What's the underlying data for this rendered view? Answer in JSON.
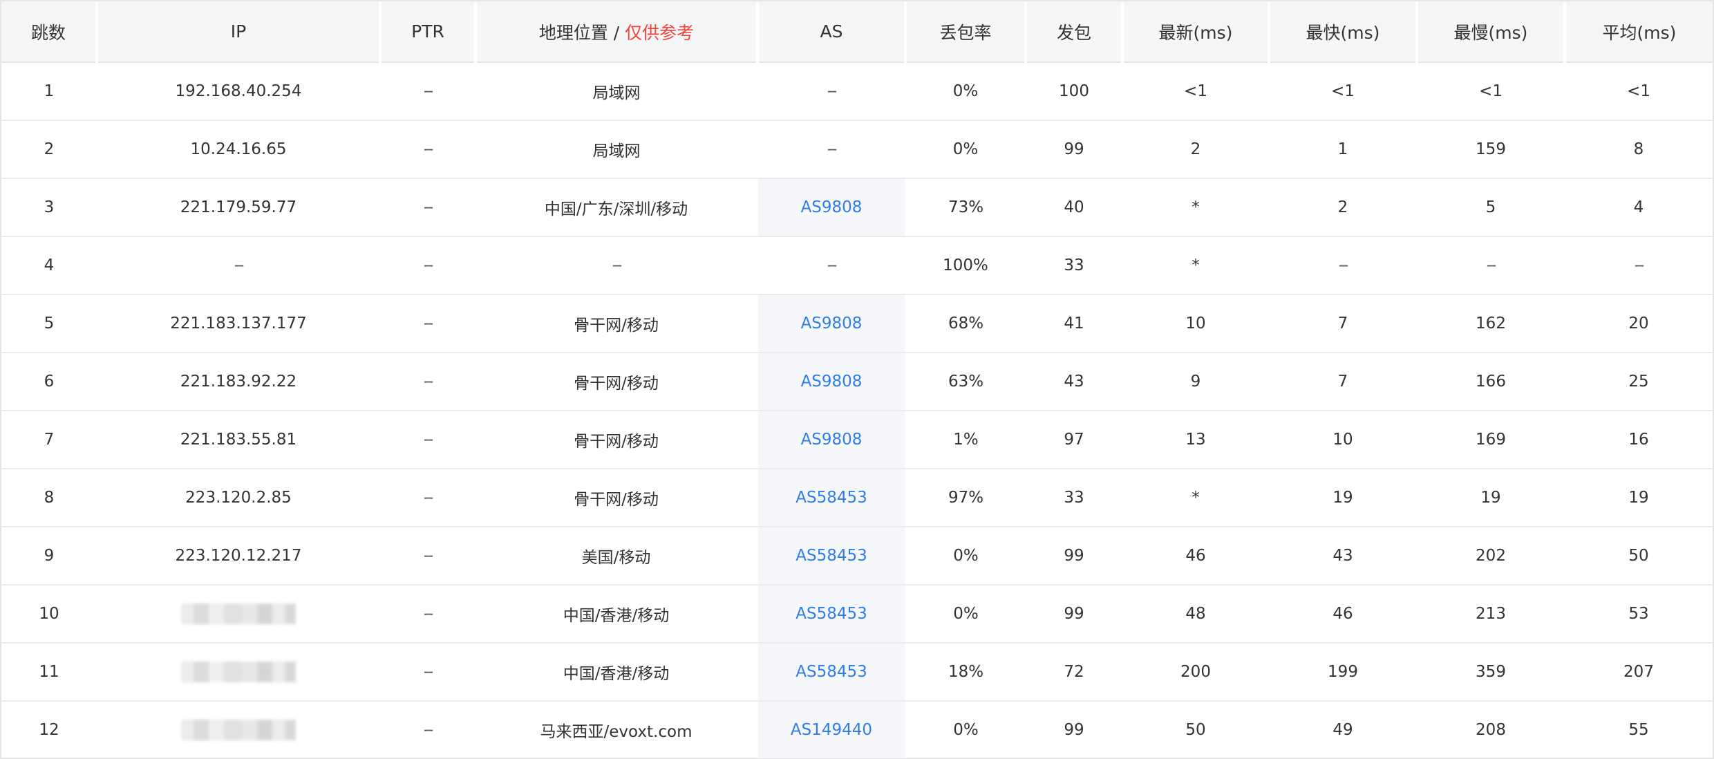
{
  "headers": {
    "hop": "跳数",
    "ip": "IP",
    "ptr": "PTR",
    "geo": "地理位置",
    "geo_sep": " / ",
    "geo_note": "仅供参考",
    "as": "AS",
    "loss": "丢包率",
    "sent": "发包",
    "last": "最新(ms)",
    "best": "最快(ms)",
    "worst": "最慢(ms)",
    "avg": "平均(ms)"
  },
  "colors": {
    "as_link": "#2f7ee8",
    "reference_note": "#f0443b",
    "header_bg": "#f5f6f8",
    "as_cell_bg": "#f5f7fa"
  },
  "rows": [
    {
      "hop": "1",
      "ip": "192.168.40.254",
      "ptr": "--",
      "geo": "局域网",
      "as": "--",
      "loss": "0%",
      "sent": "100",
      "last": "<1",
      "best": "<1",
      "worst": "<1",
      "avg": "<1"
    },
    {
      "hop": "2",
      "ip": "10.24.16.65",
      "ptr": "--",
      "geo": "局域网",
      "as": "--",
      "loss": "0%",
      "sent": "99",
      "last": "2",
      "best": "1",
      "worst": "159",
      "avg": "8"
    },
    {
      "hop": "3",
      "ip": "221.179.59.77",
      "ptr": "--",
      "geo": "中国/广东/深圳/移动",
      "as": "AS9808",
      "loss": "73%",
      "sent": "40",
      "last": "*",
      "best": "2",
      "worst": "5",
      "avg": "4"
    },
    {
      "hop": "4",
      "ip": "--",
      "ptr": "--",
      "geo": "--",
      "as": "--",
      "loss": "100%",
      "sent": "33",
      "last": "*",
      "best": "--",
      "worst": "--",
      "avg": "--"
    },
    {
      "hop": "5",
      "ip": "221.183.137.177",
      "ptr": "--",
      "geo": "骨干网/移动",
      "as": "AS9808",
      "loss": "68%",
      "sent": "41",
      "last": "10",
      "best": "7",
      "worst": "162",
      "avg": "20"
    },
    {
      "hop": "6",
      "ip": "221.183.92.22",
      "ptr": "--",
      "geo": "骨干网/移动",
      "as": "AS9808",
      "loss": "63%",
      "sent": "43",
      "last": "9",
      "best": "7",
      "worst": "166",
      "avg": "25"
    },
    {
      "hop": "7",
      "ip": "221.183.55.81",
      "ptr": "--",
      "geo": "骨干网/移动",
      "as": "AS9808",
      "loss": "1%",
      "sent": "97",
      "last": "13",
      "best": "10",
      "worst": "169",
      "avg": "16"
    },
    {
      "hop": "8",
      "ip": "223.120.2.85",
      "ptr": "--",
      "geo": "骨干网/移动",
      "as": "AS58453",
      "loss": "97%",
      "sent": "33",
      "last": "*",
      "best": "19",
      "worst": "19",
      "avg": "19"
    },
    {
      "hop": "9",
      "ip": "223.120.12.217",
      "ptr": "--",
      "geo": "美国/移动",
      "as": "AS58453",
      "loss": "0%",
      "sent": "99",
      "last": "46",
      "best": "43",
      "worst": "202",
      "avg": "50"
    },
    {
      "hop": "10",
      "ip": "",
      "ptr": "--",
      "geo": "中国/香港/移动",
      "as": "AS58453",
      "loss": "0%",
      "sent": "99",
      "last": "48",
      "best": "46",
      "worst": "213",
      "avg": "53"
    },
    {
      "hop": "11",
      "ip": "",
      "ptr": "--",
      "geo": "中国/香港/移动",
      "as": "AS58453",
      "loss": "18%",
      "sent": "72",
      "last": "200",
      "best": "199",
      "worst": "359",
      "avg": "207"
    },
    {
      "hop": "12",
      "ip": "",
      "ptr": "--",
      "geo": "马来西亚/evoxt.com",
      "as": "AS149440",
      "loss": "0%",
      "sent": "99",
      "last": "50",
      "best": "49",
      "worst": "208",
      "avg": "55"
    }
  ]
}
